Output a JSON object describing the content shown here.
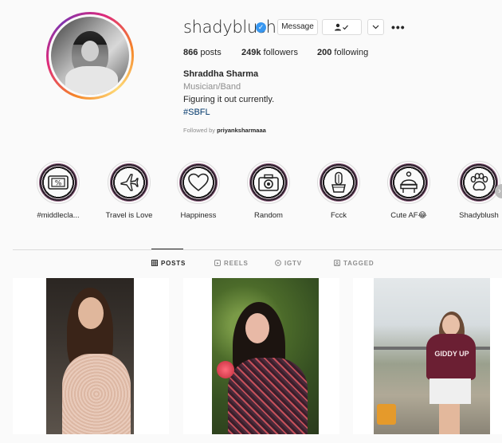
{
  "profile": {
    "username": "shadyblush",
    "verified": true,
    "buttons": {
      "message": "Message",
      "follow_icon": "person-check-icon",
      "more_options_icon": "chevron-down-icon"
    },
    "stats": {
      "posts_count": "866",
      "posts_label": "posts",
      "followers_count": "249k",
      "followers_label": "followers",
      "following_count": "200",
      "following_label": "following"
    },
    "full_name": "Shraddha Sharma",
    "category": "Musician/Band",
    "bio": "Figuring it out currently.",
    "hashtag": "#SBFL",
    "followed_by_prefix": "Followed by ",
    "followed_by_name": "priyanksharmaaa"
  },
  "highlights": [
    {
      "label": "#middlecla...",
      "icon": "ticket-icon"
    },
    {
      "label": "Travel is Love",
      "icon": "airplane-icon"
    },
    {
      "label": "Happiness",
      "icon": "heart-icon"
    },
    {
      "label": "Random",
      "icon": "camera-icon"
    },
    {
      "label": "Fcck",
      "icon": "cactus-icon"
    },
    {
      "label": "Cute AF😂",
      "icon": "beanie-icon"
    },
    {
      "label": "Shadyblush",
      "icon": "paw-icon"
    }
  ],
  "tabs": [
    {
      "label": "POSTS",
      "icon": "grid-icon",
      "active": true
    },
    {
      "label": "REELS",
      "icon": "reels-icon",
      "active": false
    },
    {
      "label": "IGTV",
      "icon": "igtv-icon",
      "active": false
    },
    {
      "label": "TAGGED",
      "icon": "tagged-icon",
      "active": false
    }
  ],
  "posts": [
    {
      "overlay_text": ""
    },
    {
      "overlay_text": ""
    },
    {
      "overlay_text": "GIDDY UP"
    }
  ],
  "colors": {
    "background": "#fafafa",
    "text": "#262626",
    "muted": "#8e8e8e",
    "link": "#00376b",
    "verified": "#3897f0",
    "border": "#dbdbdb"
  }
}
